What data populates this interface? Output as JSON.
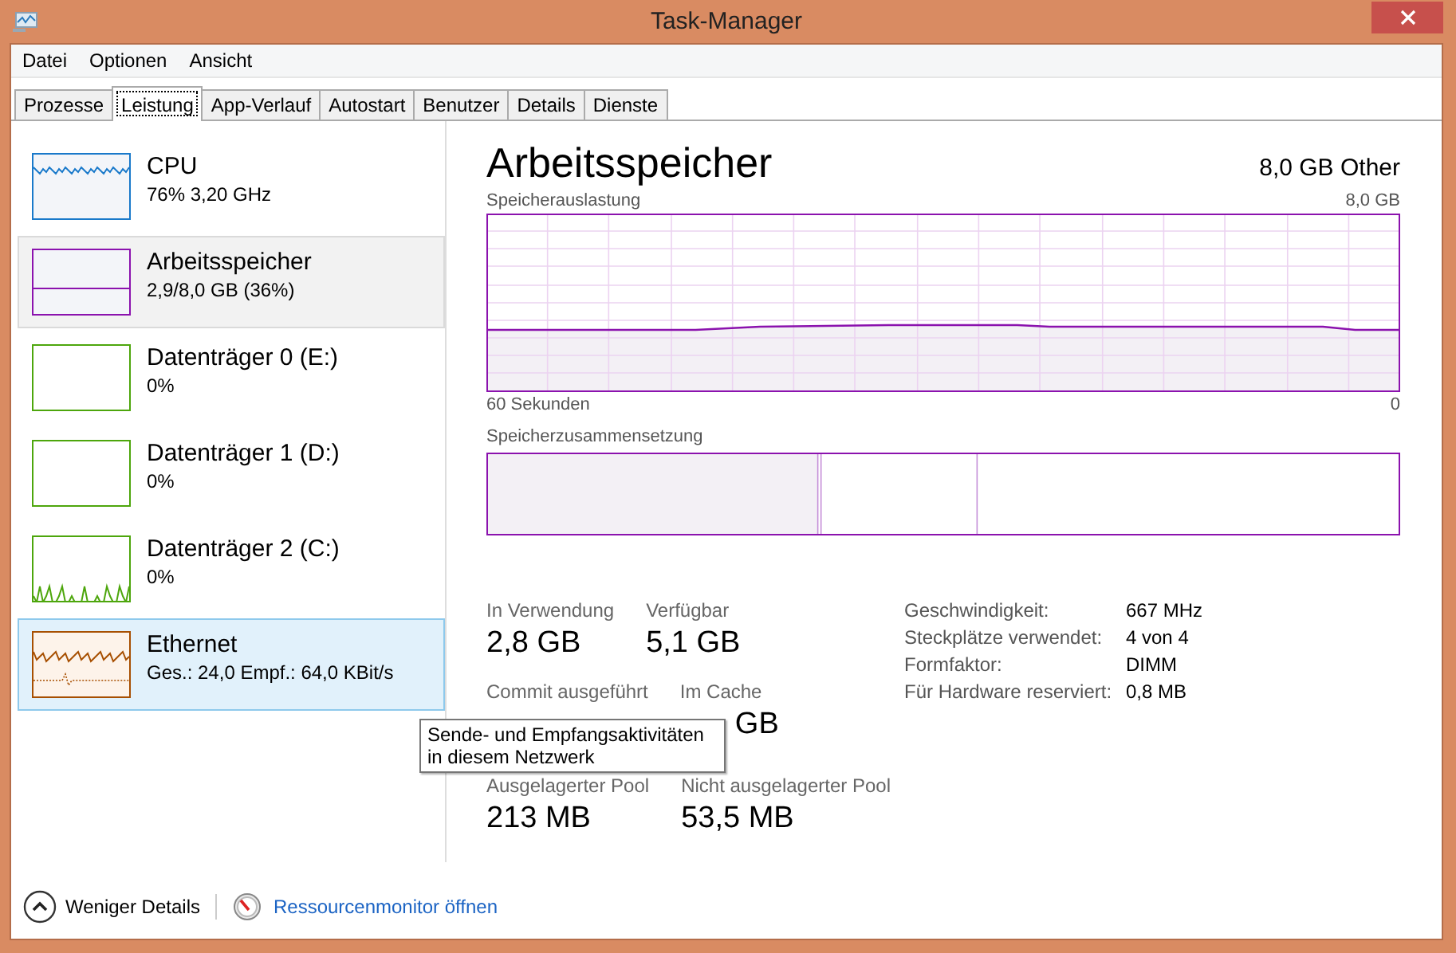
{
  "window": {
    "title": "Task-Manager"
  },
  "menu": [
    "Datei",
    "Optionen",
    "Ansicht"
  ],
  "tabs": [
    {
      "label": "Prozesse",
      "selected": false
    },
    {
      "label": "Leistung",
      "selected": true
    },
    {
      "label": "App-Verlauf",
      "selected": false
    },
    {
      "label": "Autostart",
      "selected": false
    },
    {
      "label": "Benutzer",
      "selected": false
    },
    {
      "label": "Details",
      "selected": false
    },
    {
      "label": "Dienste",
      "selected": false
    }
  ],
  "sidebar": {
    "items": [
      {
        "name": "CPU",
        "detail": "76% 3,20 GHz",
        "color": "#1979ca",
        "selected": false,
        "hovered": false
      },
      {
        "name": "Arbeitsspeicher",
        "detail": "2,9/8,0 GB (36%)",
        "color": "#8b12ae",
        "selected": true,
        "hovered": false
      },
      {
        "name": "Datenträger 0 (E:)",
        "detail": "0%",
        "color": "#4da60c",
        "selected": false,
        "hovered": false
      },
      {
        "name": "Datenträger 1 (D:)",
        "detail": "0%",
        "color": "#4da60c",
        "selected": false,
        "hovered": false
      },
      {
        "name": "Datenträger 2 (C:)",
        "detail": "0%",
        "color": "#4da60c",
        "selected": false,
        "hovered": false
      },
      {
        "name": "Ethernet",
        "detail": "Ges.: 24,0 Empf.: 64,0 KBit/s",
        "color": "#a74f01",
        "selected": false,
        "hovered": true
      }
    ]
  },
  "main": {
    "title": "Arbeitsspeicher",
    "subtitle": "8,0 GB Other",
    "usage_graph": {
      "label": "Speicherauslastung",
      "max_label": "8,0 GB",
      "left_label": "60 Sekunden",
      "right_label": "0"
    },
    "composition": {
      "label": "Speicherzusammensetzung"
    },
    "stats": [
      [
        {
          "label": "In Verwendung",
          "value": "2,8 GB"
        },
        {
          "label": "Verfügbar",
          "value": "5,1 GB"
        }
      ],
      [
        {
          "label": "Commit ausgeführt"
        },
        {
          "label": "Im Cache",
          "value": "GB"
        }
      ],
      [
        {
          "label": "Ausgelagerter Pool",
          "value": "213 MB"
        },
        {
          "label": "Nicht ausgelagerter Pool",
          "value": "53,5 MB"
        }
      ]
    ],
    "details": [
      {
        "key": "Geschwindigkeit:",
        "value": "667 MHz"
      },
      {
        "key": "Steckplätze verwendet:",
        "value": "4 von 4"
      },
      {
        "key": "Formfaktor:",
        "value": "DIMM"
      },
      {
        "key": "Für Hardware reserviert:",
        "value": "0,8 MB"
      }
    ]
  },
  "tooltip": "Sende- und Empfangsaktivitäten in diesem Netzwerk",
  "footer": {
    "less_details": "Weniger Details",
    "resource_monitor": "Ressourcenmonitor öffnen"
  }
}
